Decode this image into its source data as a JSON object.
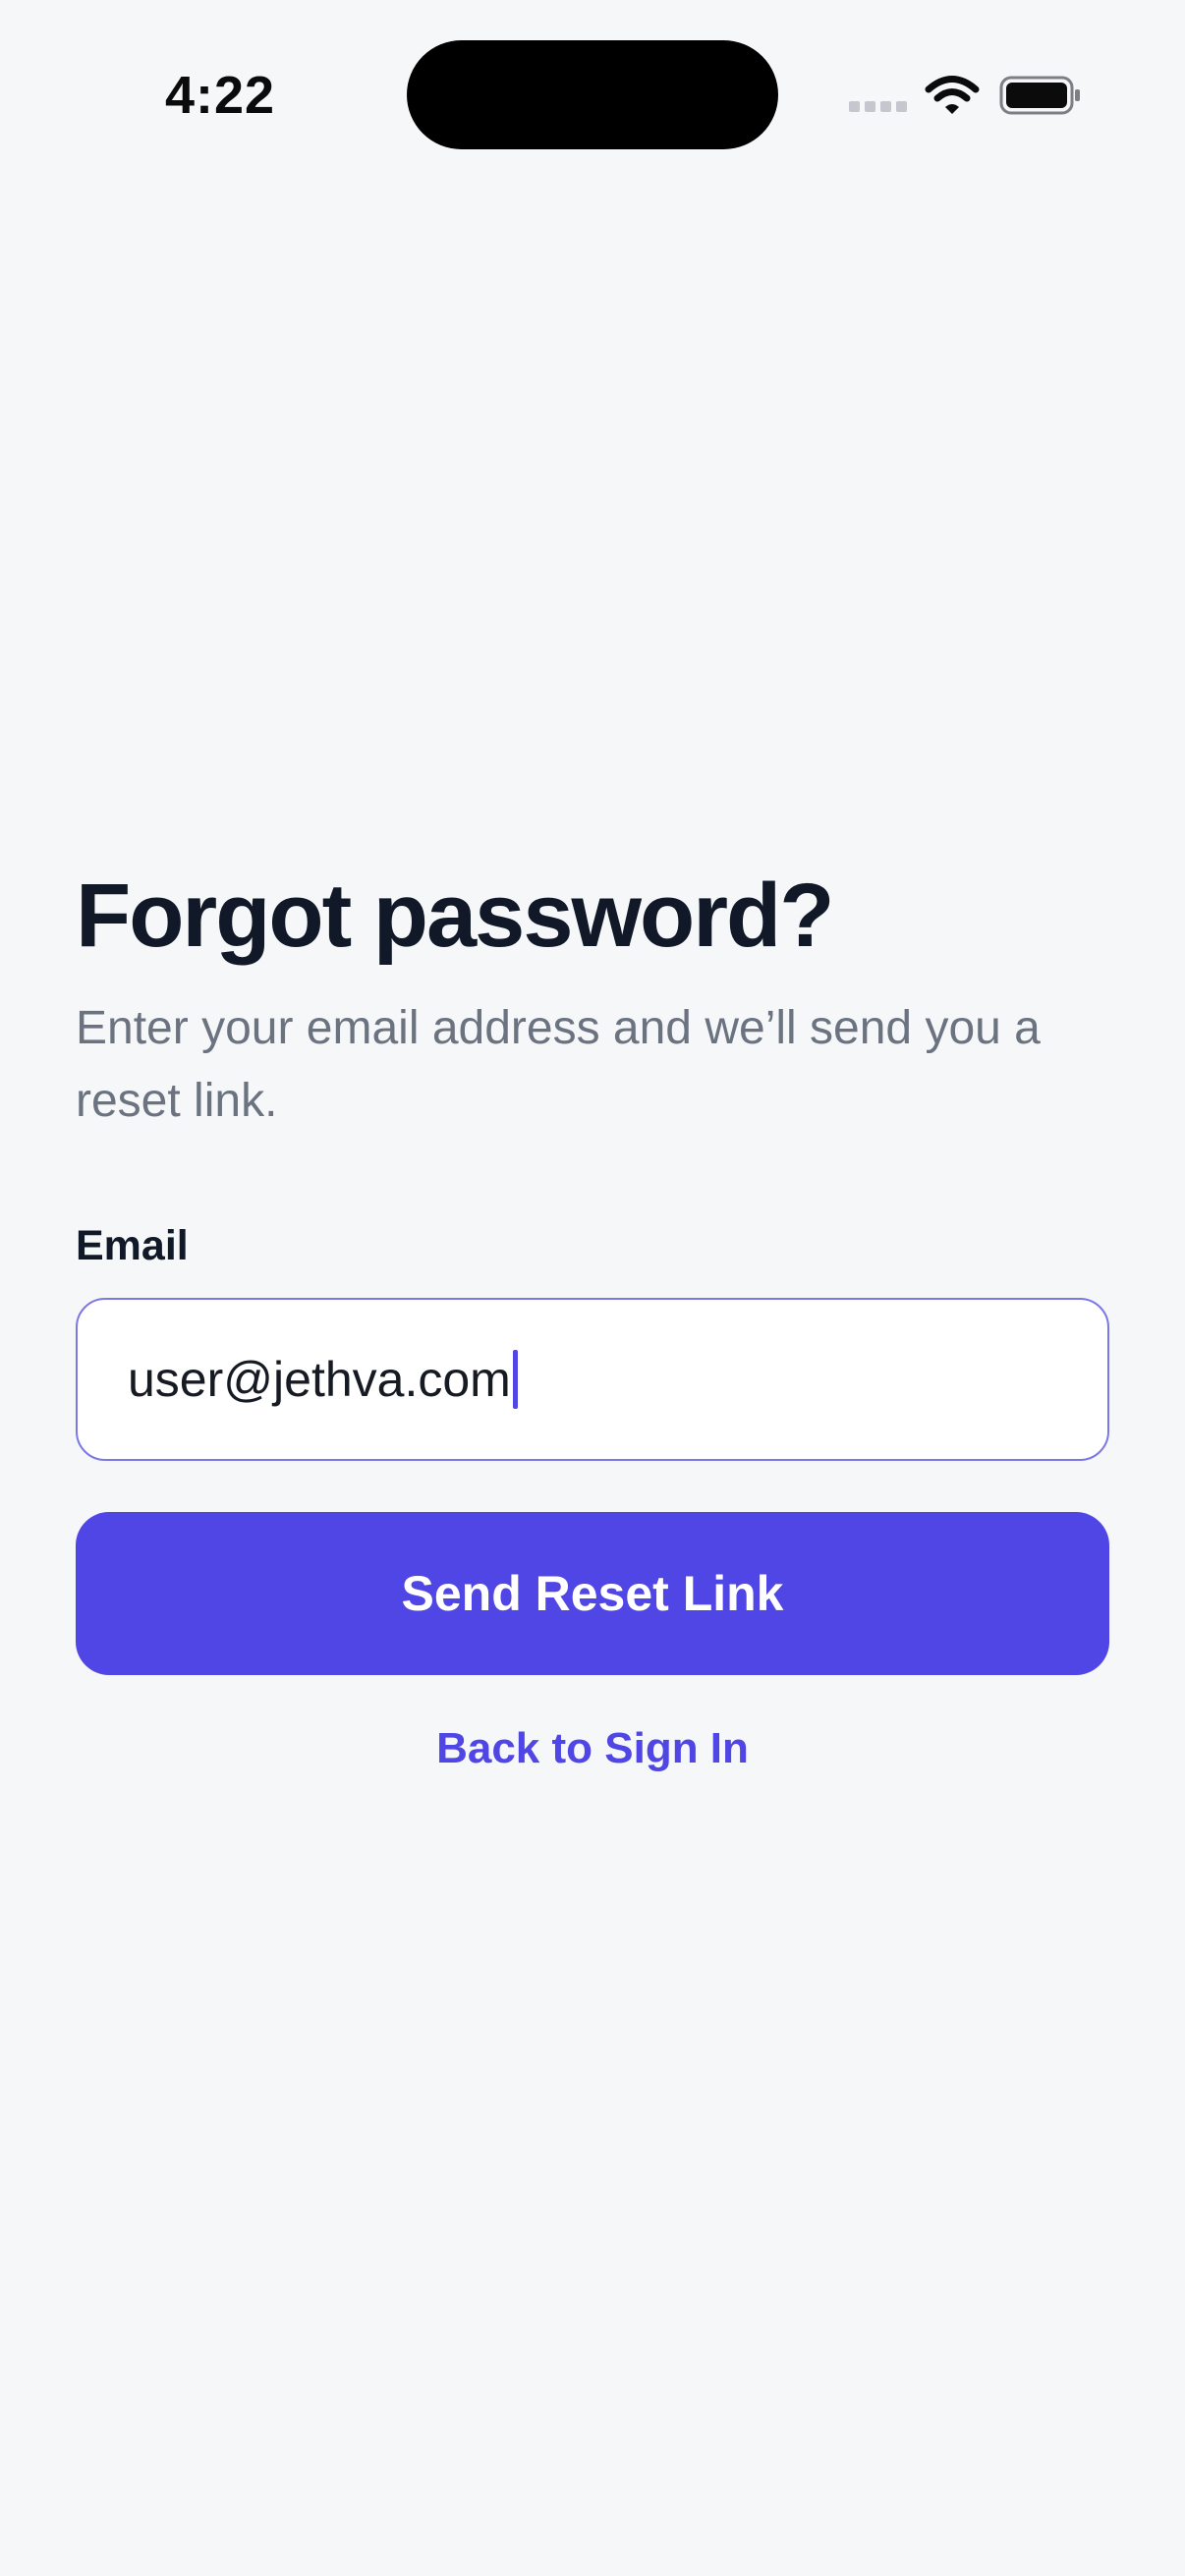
{
  "status_bar": {
    "time": "4:22",
    "icons": [
      "signal-icon",
      "wifi-icon",
      "battery-icon"
    ]
  },
  "page": {
    "title": "Forgot password?",
    "subtitle": "Enter your email address and we’ll send you a reset link."
  },
  "form": {
    "email_label": "Email",
    "email_value": "user@jethva.com",
    "submit_label": "Send Reset Link",
    "back_link_label": "Back to Sign In"
  },
  "colors": {
    "background": "#f6f7f9",
    "accent": "#4f46e5",
    "title_text": "#111827",
    "muted_text": "#6b7280"
  }
}
